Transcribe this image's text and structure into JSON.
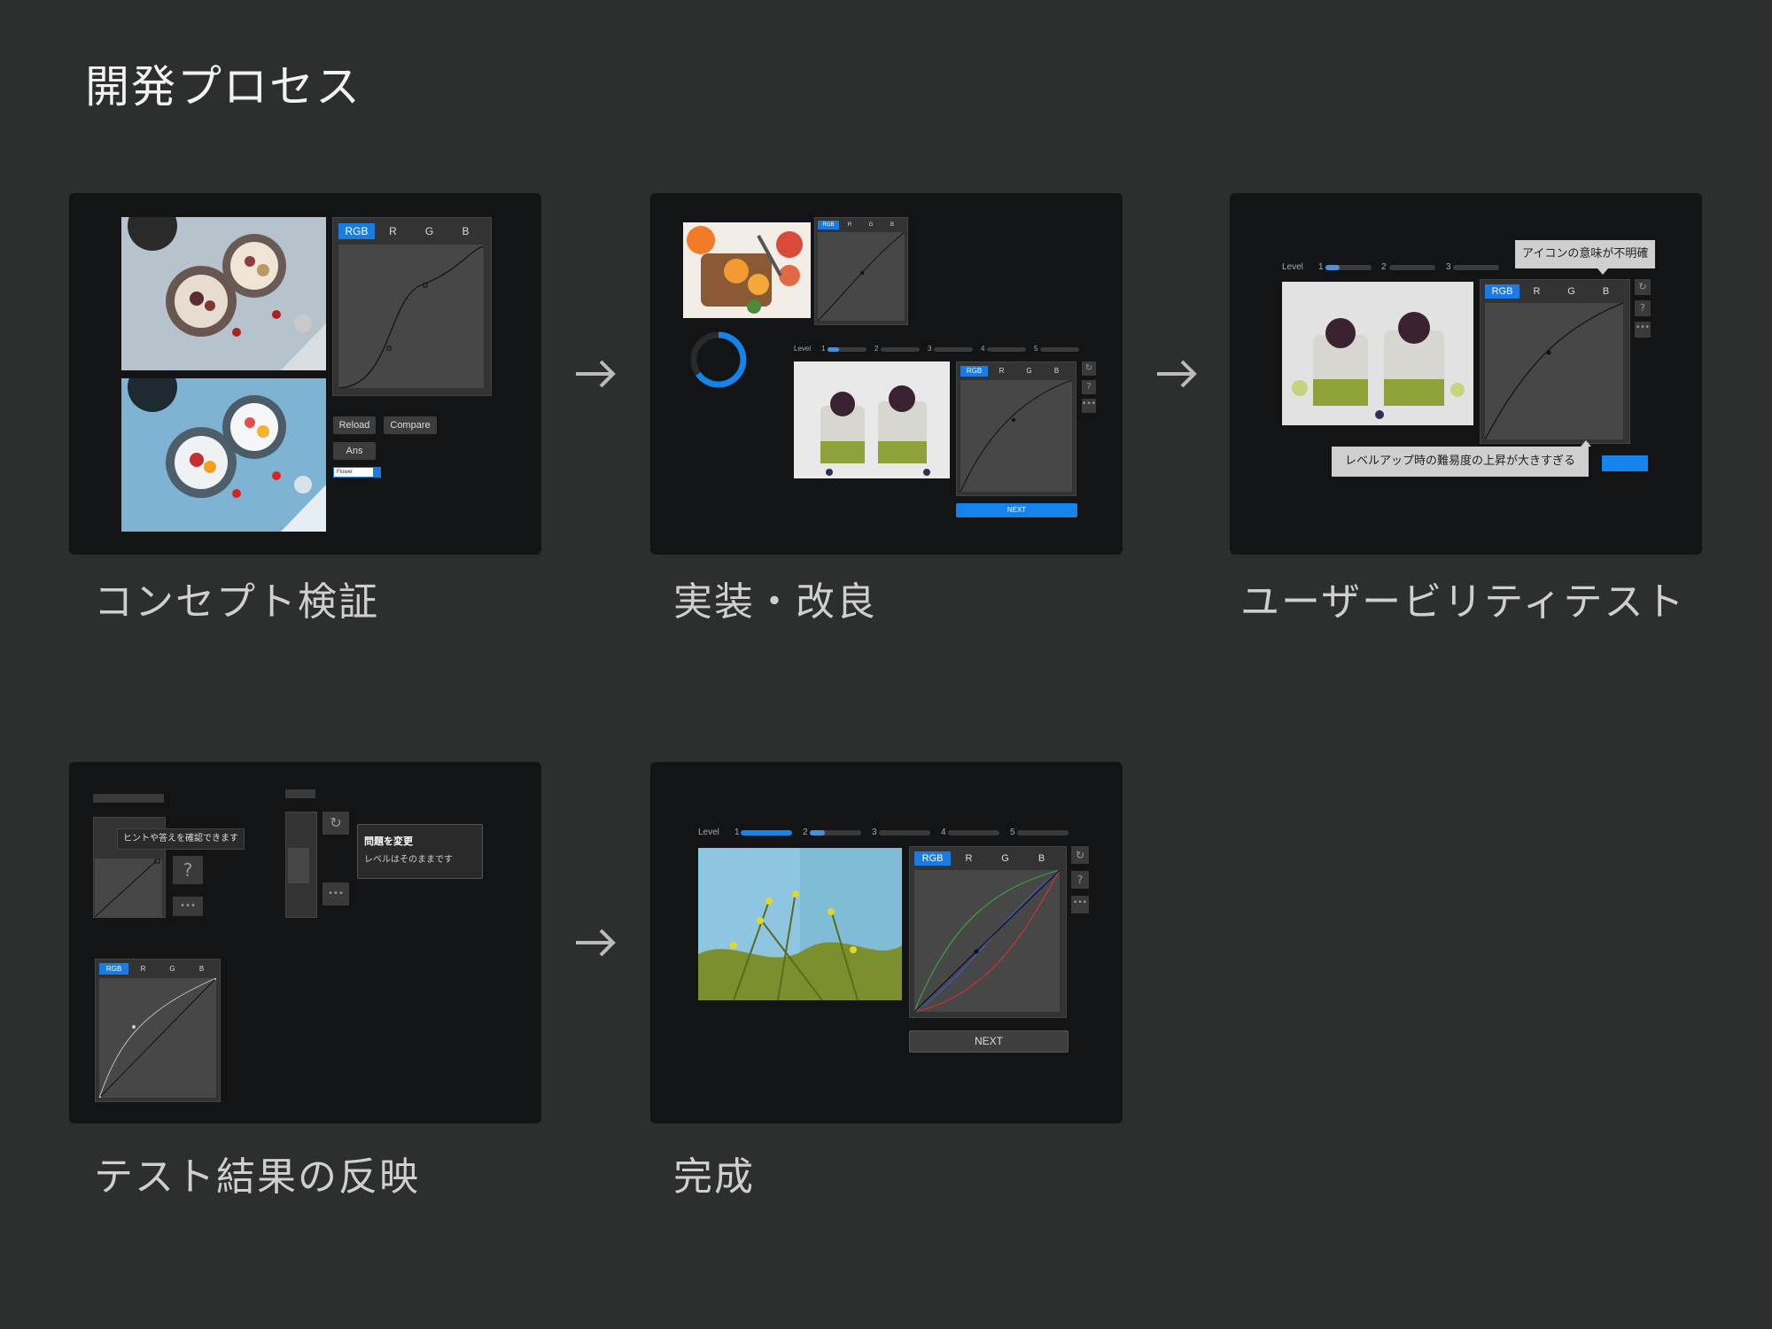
{
  "title": "開発プロセス",
  "steps": [
    {
      "caption": "コンセプト検証"
    },
    {
      "caption": "実装・改良"
    },
    {
      "caption": "ユーザービリティテスト"
    },
    {
      "caption": "テスト結果の反映"
    },
    {
      "caption": "完成"
    }
  ],
  "tabs": [
    "RGB",
    "R",
    "G",
    "B"
  ],
  "concept": {
    "reload": "Reload",
    "compare": "Compare",
    "ans": "Ans",
    "select_value": "Flower"
  },
  "level_label": "Level",
  "levels": [
    "1",
    "2",
    "3",
    "4",
    "5"
  ],
  "next_label": "NEXT",
  "tooltips": {
    "icon_unclear": "アイコンの意味が不明確",
    "level_difficulty": "レベルアップ時の難易度の上昇が大きすぎる",
    "hint": "ヒントや答えを確認できます",
    "change_title": "問題を変更",
    "change_sub": "レベルはそのままです"
  },
  "icons": {
    "reset": "reset-icon",
    "help": "question-icon",
    "more": "more-icon",
    "arrow": "arrow-right-icon"
  },
  "colors": {
    "accent": "#1a7be0",
    "background": "#2d2e2e",
    "card": "#131415"
  }
}
